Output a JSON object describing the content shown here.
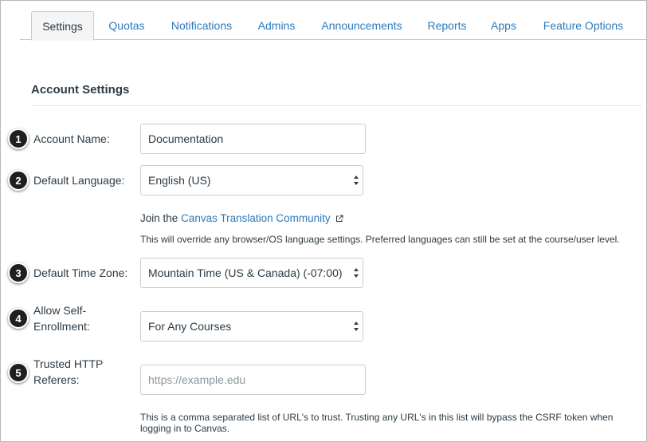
{
  "tabs": [
    {
      "label": "Settings",
      "active": true
    },
    {
      "label": "Quotas",
      "active": false
    },
    {
      "label": "Notifications",
      "active": false
    },
    {
      "label": "Admins",
      "active": false
    },
    {
      "label": "Announcements",
      "active": false
    },
    {
      "label": "Reports",
      "active": false
    },
    {
      "label": "Apps",
      "active": false
    },
    {
      "label": "Feature Options",
      "active": false
    }
  ],
  "section": {
    "title": "Account Settings"
  },
  "callouts": [
    "1",
    "2",
    "3",
    "4",
    "5"
  ],
  "account_name": {
    "label": "Account Name:",
    "value": "Documentation"
  },
  "default_language": {
    "label": "Default Language:",
    "selected": "English (US)",
    "join_prefix": "Join the",
    "join_link": "Canvas Translation Community",
    "help": "This will override any browser/OS language settings. Preferred languages can still be set at the course/user level."
  },
  "time_zone": {
    "label": "Default Time Zone:",
    "selected": "Mountain Time (US & Canada) (-07:00)"
  },
  "self_enrollment": {
    "label_line1": "Allow Self-",
    "label_line2": "Enrollment:",
    "selected": "For Any Courses"
  },
  "trusted_referers": {
    "label_line1": "Trusted HTTP",
    "label_line2": "Referers:",
    "placeholder": "https://example.edu",
    "help": "This is a comma separated list of URL's to trust. Trusting any URL's in this list will bypass the CSRF token when logging in to Canvas."
  },
  "colors": {
    "link": "#2b7abc",
    "text": "#2d3b45",
    "callout": "#1f1f1f",
    "border": "#c7cdd1"
  },
  "icons": {
    "external_link": "external-link-icon",
    "select": "select-arrows-icon"
  }
}
